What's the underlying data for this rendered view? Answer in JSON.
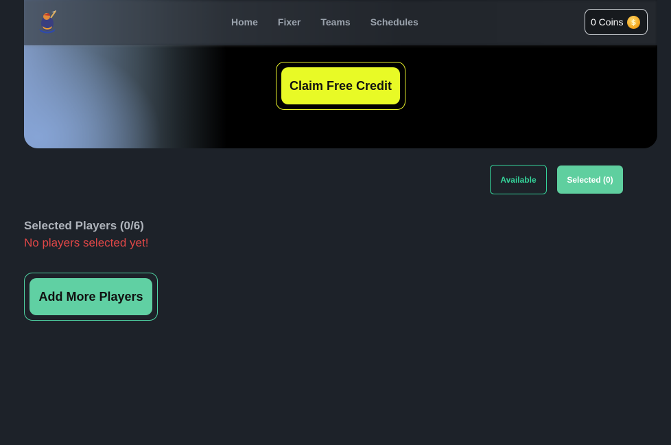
{
  "nav": {
    "items": [
      {
        "label": "Home"
      },
      {
        "label": "Fixer"
      },
      {
        "label": "Teams"
      },
      {
        "label": "Schedules"
      }
    ],
    "coins_label": "0 Coins"
  },
  "hero": {
    "claim_label": "Claim Free Credit"
  },
  "tabs": {
    "available_label": "Available",
    "selected_label": "Selected (0)"
  },
  "selection": {
    "title": "Selected Players (0/6)",
    "empty_message": "No players selected yet!",
    "add_label": "Add More Players"
  },
  "colors": {
    "accent_yellow": "#e8fa26",
    "accent_green": "#60d0a3",
    "error_red": "#e04747",
    "background": "#1d2229"
  }
}
